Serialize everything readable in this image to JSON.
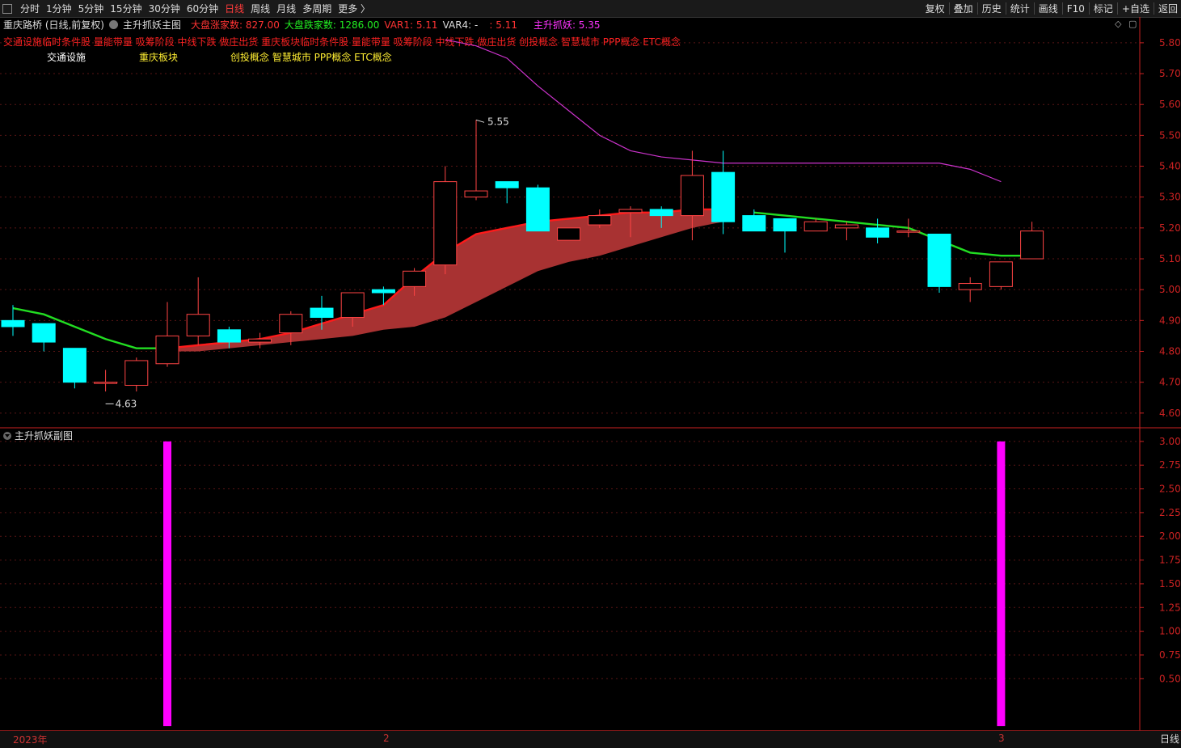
{
  "toolbar": {
    "periods": [
      "分时",
      "1分钟",
      "5分钟",
      "15分钟",
      "30分钟",
      "60分钟",
      "日线",
      "周线",
      "月线",
      "多周期",
      "更多 〉"
    ],
    "active_period": "日线",
    "right_items": [
      "复权",
      "叠加",
      "历史",
      "统计",
      "画线",
      "F10",
      "标记",
      "+自选",
      "返回"
    ]
  },
  "header": {
    "stock_title": "重庆路桥 (日线,前复权)",
    "indicator_name": "主升抓妖主图",
    "up_count_label": "大盘涨家数: 827.00",
    "down_count_label": "大盘跌家数: 1286.00",
    "var1_label": "VAR1: 5.11",
    "var4_label": "VAR4: -",
    "var_extra_label": ": 5.11",
    "main_label": "主升抓妖: 5.35"
  },
  "concept_line": "交通设施临时条件股 量能带量 吸筹阶段 中线下跌 做庄出货 重庆板块临时条件股 量能带量 吸筹阶段 中线下跌 做庄出货 创投概念 智慧城市 PPP概念 ETC概念",
  "tags": {
    "sector1": "交通设施",
    "sector2": "重庆板块",
    "concepts": "创投概念 智慧城市 PPP概念 ETC概念"
  },
  "sub_chart_title": "主升抓妖副图",
  "bottom": {
    "year_label": "2023年",
    "month2_label": "2",
    "month3_label": "3",
    "period_button": "日线"
  },
  "colors": {
    "up": "#ff4444",
    "down": "#00ffff",
    "ma_up": "#ff1a1a",
    "ma_down": "#22dd22",
    "band_fill": "#a83232",
    "purple_line": "#cc33cc",
    "signal_bar": "#ff00ff",
    "axis": "#cc2222"
  },
  "chart_data": [
    {
      "type": "candlestick",
      "title": "重庆路桥 (日线,前复权)",
      "y_ticks": [
        4.6,
        4.7,
        4.8,
        4.9,
        5.0,
        5.1,
        5.2,
        5.3,
        5.4,
        5.5,
        5.6,
        5.7,
        5.8
      ],
      "ylim": [
        4.555,
        5.86
      ],
      "annotations": [
        {
          "label": "5.55",
          "x": 15,
          "value": 5.55
        },
        {
          "label": "4.63",
          "x": 3,
          "value": 4.63
        }
      ],
      "candles": [
        {
          "open": 4.9,
          "close": 4.88,
          "high": 4.95,
          "low": 4.85
        },
        {
          "open": 4.89,
          "close": 4.83,
          "high": 4.89,
          "low": 4.8
        },
        {
          "open": 4.81,
          "close": 4.7,
          "high": 4.81,
          "low": 4.68
        },
        {
          "open": 4.7,
          "close": 4.7,
          "high": 4.74,
          "low": 4.67
        },
        {
          "open": 4.69,
          "close": 4.77,
          "high": 4.78,
          "low": 4.67
        },
        {
          "open": 4.76,
          "close": 4.85,
          "high": 4.96,
          "low": 4.75
        },
        {
          "open": 4.85,
          "close": 4.92,
          "high": 5.04,
          "low": 4.82
        },
        {
          "open": 4.87,
          "close": 4.83,
          "high": 4.88,
          "low": 4.81
        },
        {
          "open": 4.83,
          "close": 4.84,
          "high": 4.86,
          "low": 4.81
        },
        {
          "open": 4.86,
          "close": 4.92,
          "high": 4.93,
          "low": 4.82
        },
        {
          "open": 4.94,
          "close": 4.91,
          "high": 4.98,
          "low": 4.87
        },
        {
          "open": 4.91,
          "close": 4.99,
          "high": 4.99,
          "low": 4.88
        },
        {
          "open": 5.0,
          "close": 4.99,
          "high": 5.01,
          "low": 4.95
        },
        {
          "open": 5.01,
          "close": 5.06,
          "high": 5.07,
          "low": 4.98
        },
        {
          "open": 5.08,
          "close": 5.35,
          "high": 5.4,
          "low": 5.05
        },
        {
          "open": 5.3,
          "close": 5.32,
          "high": 5.55,
          "low": 5.29
        },
        {
          "open": 5.35,
          "close": 5.33,
          "high": 5.35,
          "low": 5.28
        },
        {
          "open": 5.33,
          "close": 5.19,
          "high": 5.34,
          "low": 5.19
        },
        {
          "open": 5.16,
          "close": 5.2,
          "high": 5.2,
          "low": 5.16
        },
        {
          "open": 5.21,
          "close": 5.24,
          "high": 5.26,
          "low": 5.2
        },
        {
          "open": 5.25,
          "close": 5.26,
          "high": 5.27,
          "low": 5.17
        },
        {
          "open": 5.26,
          "close": 5.24,
          "high": 5.27,
          "low": 5.2
        },
        {
          "open": 5.24,
          "close": 5.37,
          "high": 5.45,
          "low": 5.16
        },
        {
          "open": 5.38,
          "close": 5.22,
          "high": 5.45,
          "low": 5.18
        },
        {
          "open": 5.24,
          "close": 5.19,
          "high": 5.26,
          "low": 5.19
        },
        {
          "open": 5.23,
          "close": 5.19,
          "high": 5.23,
          "low": 5.12
        },
        {
          "open": 5.19,
          "close": 5.22,
          "high": 5.23,
          "low": 5.19
        },
        {
          "open": 5.2,
          "close": 5.21,
          "high": 5.22,
          "low": 5.16
        },
        {
          "open": 5.2,
          "close": 5.17,
          "high": 5.23,
          "low": 5.15
        },
        {
          "open": 5.19,
          "close": 5.19,
          "high": 5.23,
          "low": 5.17
        },
        {
          "open": 5.18,
          "close": 5.01,
          "high": 5.18,
          "low": 4.99
        },
        {
          "open": 5.0,
          "close": 5.02,
          "high": 5.04,
          "low": 4.96
        },
        {
          "open": 5.01,
          "close": 5.09,
          "high": 5.09,
          "low": 5.0
        },
        {
          "open": 5.1,
          "close": 5.19,
          "high": 5.22,
          "low": 5.1
        }
      ],
      "band_upper": [
        null,
        null,
        null,
        null,
        null,
        4.81,
        4.82,
        4.83,
        4.84,
        4.86,
        4.89,
        4.92,
        4.95,
        5.04,
        5.12,
        5.18,
        5.2,
        5.22,
        5.23,
        5.24,
        5.25,
        5.25,
        5.26,
        5.26
      ],
      "band_lower": [
        null,
        null,
        null,
        null,
        null,
        4.8,
        4.8,
        4.81,
        4.82,
        4.83,
        4.84,
        4.85,
        4.87,
        4.88,
        4.91,
        4.96,
        5.01,
        5.06,
        5.09,
        5.11,
        5.14,
        5.17,
        5.2,
        5.22
      ],
      "trend_line": [
        4.94,
        4.92,
        4.88,
        4.84,
        4.81,
        4.81,
        null,
        null,
        null,
        null,
        null,
        null,
        null,
        null,
        null,
        null,
        null,
        null,
        null,
        null,
        null,
        null,
        null,
        null,
        5.25,
        5.24,
        5.23,
        5.22,
        5.21,
        5.2,
        5.16,
        5.12,
        5.11,
        5.11
      ],
      "trend_line_red_from": 5,
      "trend_line_red_to": 23,
      "purple_line": [
        null,
        null,
        null,
        null,
        null,
        null,
        null,
        null,
        null,
        null,
        null,
        null,
        null,
        null,
        5.81,
        5.79,
        5.75,
        5.66,
        5.58,
        5.5,
        5.45,
        5.43,
        5.42,
        5.41,
        5.41,
        5.41,
        5.41,
        5.41,
        5.41,
        5.41,
        5.41,
        5.39,
        5.35
      ],
      "grid": true
    },
    {
      "type": "bar",
      "title": "主升抓妖副图",
      "y_ticks": [
        0.5,
        0.75,
        1.0,
        1.25,
        1.5,
        1.75,
        2.0,
        2.25,
        2.5,
        2.75,
        3.0
      ],
      "ylim": [
        0,
        3.05
      ],
      "bars": [
        {
          "index": 5,
          "value": 3.0
        },
        {
          "index": 32,
          "value": 3.0
        }
      ],
      "grid": true
    }
  ]
}
